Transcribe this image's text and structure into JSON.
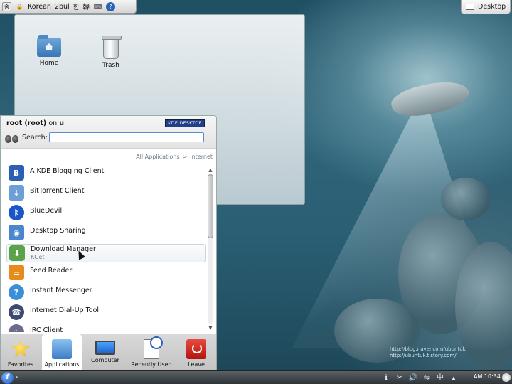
{
  "top_panel": {
    "items": [
      {
        "name": "input-method-icon",
        "glyph": "중"
      },
      {
        "name": "lock-icon",
        "glyph": "🔒"
      },
      {
        "name": "language-label",
        "label": "Korean"
      },
      {
        "name": "keyboard-layout-label",
        "label": "2bul"
      },
      {
        "name": "hangul-mode-label",
        "label": "한"
      },
      {
        "name": "hanja-mode-label",
        "label": "韓"
      },
      {
        "name": "keyboard-icon",
        "glyph": "⌨"
      },
      {
        "name": "help-icon",
        "glyph": "?"
      }
    ]
  },
  "desktop_button": {
    "label": "Desktop"
  },
  "folderview": {
    "items": [
      {
        "label": "Home"
      },
      {
        "label": "Trash"
      }
    ]
  },
  "kickoff": {
    "user": {
      "name": "root",
      "login": "(root)",
      "on": "on",
      "host": "u"
    },
    "badge": "KDE DESKTOP",
    "search_label": "Search:",
    "search_value": "",
    "breadcrumb": {
      "root": "All Applications",
      "separator": ">",
      "current": "Internet"
    },
    "apps": [
      {
        "label": "A KDE Blogging Client",
        "sub": "",
        "icon": "blogilo-icon",
        "color": "#2b5fb3",
        "glyph": "B"
      },
      {
        "label": "BitTorrent Client",
        "sub": "",
        "icon": "ktorrent-icon",
        "color": "#6c9fd8",
        "glyph": "↓"
      },
      {
        "label": "BlueDevil",
        "sub": "",
        "icon": "bluetooth-icon",
        "color": "#1a56c9",
        "glyph": "ᛒ"
      },
      {
        "label": "Desktop Sharing",
        "sub": "",
        "icon": "desktop-sharing-icon",
        "color": "#4a86d0",
        "glyph": "◉"
      },
      {
        "label": "Download Manager",
        "sub": "KGet",
        "icon": "kget-icon",
        "color": "#5aa34a",
        "glyph": "⬇"
      },
      {
        "label": "Feed Reader",
        "sub": "",
        "icon": "akregator-icon",
        "color": "#e78b1c",
        "glyph": "☰"
      },
      {
        "label": "Instant Messenger",
        "sub": "",
        "icon": "kopete-icon",
        "color": "#3a8fd8",
        "glyph": "?"
      },
      {
        "label": "Internet Dial-Up Tool",
        "sub": "",
        "icon": "kppp-icon",
        "color": "#3c4a70",
        "glyph": "☎"
      },
      {
        "label": "IRC Client",
        "sub": "",
        "icon": "konversation-icon",
        "color": "#6a6a8a",
        "glyph": "◌"
      }
    ],
    "tabs": [
      {
        "label": "Favorites",
        "icon": "star-icon"
      },
      {
        "label": "Applications",
        "icon": "applications-icon"
      },
      {
        "label": "Computer",
        "icon": "computer-icon"
      },
      {
        "label": "Recently Used",
        "icon": "recently-used-icon"
      },
      {
        "label": "Leave",
        "icon": "leave-icon"
      }
    ]
  },
  "watermark": {
    "line1": "http://blog.naver.com/ubuntuk",
    "line2": "http://ubuntuk.tistory.com/"
  },
  "taskbar": {
    "kmenu_glyph": "f",
    "clock": "AM 10:34",
    "tray": [
      {
        "name": "info-icon",
        "glyph": "ℹ"
      },
      {
        "name": "klipper-icon",
        "glyph": "✂"
      },
      {
        "name": "volume-icon",
        "glyph": "🔊"
      },
      {
        "name": "network-icon",
        "glyph": "⇋"
      },
      {
        "name": "input-method-tray-icon",
        "glyph": "中"
      },
      {
        "name": "tray-expand-icon",
        "glyph": "▲"
      }
    ]
  }
}
